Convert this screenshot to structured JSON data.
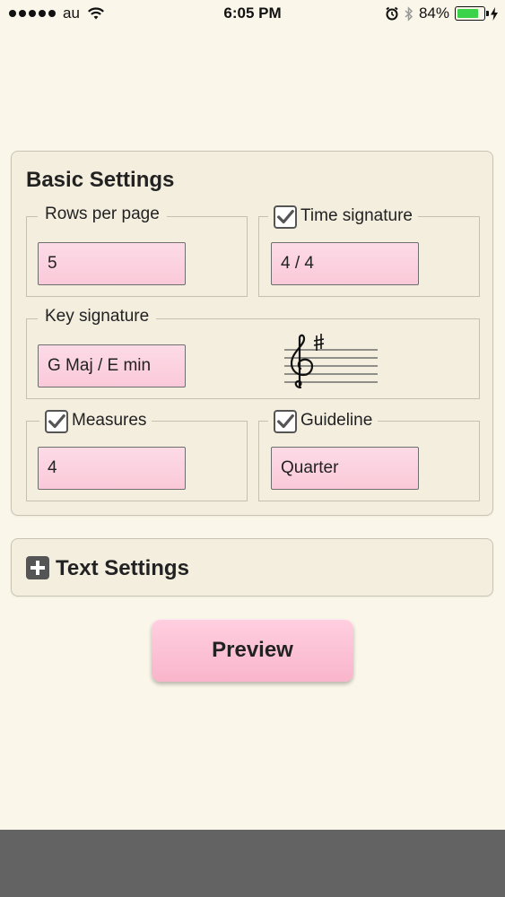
{
  "status_bar": {
    "carrier": "au",
    "time": "6:05 PM",
    "battery_percent": "84%",
    "battery_level": 0.84,
    "battery_color": "#3bd34a"
  },
  "basic_settings": {
    "title": "Basic Settings",
    "rows_per_page": {
      "label": "Rows per page",
      "value": "5"
    },
    "time_signature": {
      "label": "Time signature",
      "checked": true,
      "value": "4 / 4"
    },
    "key_signature": {
      "label": "Key signature",
      "value": "G Maj / E min"
    },
    "measures": {
      "label": "Measures",
      "checked": true,
      "value": "4"
    },
    "guideline": {
      "label": "Guideline",
      "checked": true,
      "value": "Quarter"
    }
  },
  "text_settings": {
    "label": "Text Settings"
  },
  "preview": {
    "label": "Preview"
  },
  "colors": {
    "background": "#faf6e9",
    "panel": "#f4eedf",
    "field_pink": "#fbc9d9",
    "button_pink": "#f9b5cb",
    "bottom_bar": "#636363"
  }
}
